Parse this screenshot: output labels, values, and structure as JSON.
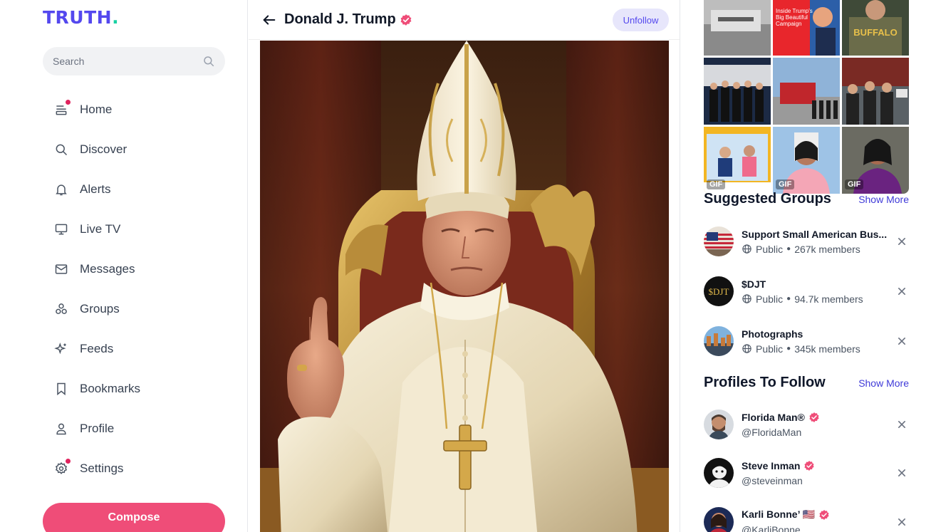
{
  "app": {
    "logo_text": "TRUTH",
    "logo_dot": ".",
    "brand_color": "#5448ee",
    "accent_color": "#ef4d78"
  },
  "search": {
    "placeholder": "Search"
  },
  "nav": {
    "items": [
      {
        "label": "Home",
        "icon": "home-icon",
        "has_dot": true
      },
      {
        "label": "Discover",
        "icon": "search-icon",
        "has_dot": false
      },
      {
        "label": "Alerts",
        "icon": "bell-icon",
        "has_dot": false
      },
      {
        "label": "Live TV",
        "icon": "monitor-icon",
        "has_dot": false
      },
      {
        "label": "Messages",
        "icon": "mail-icon",
        "has_dot": false
      },
      {
        "label": "Groups",
        "icon": "groups-icon",
        "has_dot": false
      },
      {
        "label": "Feeds",
        "icon": "sparkle-icon",
        "has_dot": false
      },
      {
        "label": "Bookmarks",
        "icon": "bookmark-icon",
        "has_dot": false
      },
      {
        "label": "Profile",
        "icon": "user-icon",
        "has_dot": false
      },
      {
        "label": "Settings",
        "icon": "gear-icon",
        "has_dot": true
      }
    ],
    "compose_label": "Compose"
  },
  "header": {
    "title": "Donald J. Trump",
    "unfollow_label": "Unfollow"
  },
  "media": {
    "gif_label": "GIF",
    "tile_texts": [
      "Inside Trump's Big Beautiful Campaign",
      "BUFFALO"
    ]
  },
  "suggested_groups": {
    "title": "Suggested Groups",
    "show_more": "Show More",
    "items": [
      {
        "name": "Support Small American Bus...",
        "privacy": "Public",
        "members": "267k members"
      },
      {
        "name": "$DJT",
        "privacy": "Public",
        "members": "94.7k members"
      },
      {
        "name": "Photographs",
        "privacy": "Public",
        "members": "345k members"
      }
    ]
  },
  "profiles_to_follow": {
    "title": "Profiles To Follow",
    "show_more": "Show More",
    "items": [
      {
        "name": "Florida Man®",
        "handle": "@FloridaMan"
      },
      {
        "name": "Steve Inman",
        "handle": "@steveinman"
      },
      {
        "name": "Karli Bonne’ 🇺🇸",
        "handle": "@KarliBonne"
      }
    ]
  }
}
